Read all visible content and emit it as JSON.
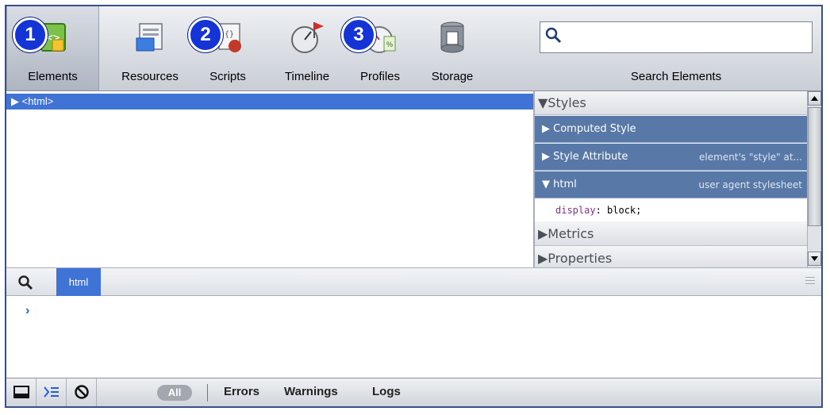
{
  "toolbar": {
    "tabs": [
      {
        "label": "Elements",
        "icon": "elements-icon",
        "selected": true,
        "badge": "1"
      },
      {
        "label": "Resources",
        "icon": "resources-icon",
        "selected": false,
        "badge": ""
      },
      {
        "label": "Scripts",
        "icon": "scripts-icon",
        "selected": false,
        "badge": "2"
      },
      {
        "label": "Timeline",
        "icon": "timeline-icon",
        "selected": false,
        "badge": ""
      },
      {
        "label": "Profiles",
        "icon": "profiles-icon",
        "selected": false,
        "badge": "3"
      },
      {
        "label": "Storage",
        "icon": "storage-icon",
        "selected": false,
        "badge": ""
      }
    ],
    "search": {
      "value": "",
      "label": "Search Elements"
    }
  },
  "elements_tree": {
    "rows": [
      {
        "text": "▶ <html>",
        "selected": true
      }
    ]
  },
  "sidebar": {
    "styles_header": "▼Styles",
    "computed_style": "▶ Computed Style",
    "style_attribute": {
      "label": "▶ Style Attribute",
      "source": "element's \"style\" at..."
    },
    "html_rule": {
      "label": "▼ html",
      "source": "user agent stylesheet"
    },
    "property": {
      "name": "display",
      "value": ": block;"
    },
    "metrics_header": "▶Metrics",
    "properties_header": "▶Properties"
  },
  "console_bar": {
    "scope_tag": "html"
  },
  "console": {
    "prompt": "›"
  },
  "status_bar": {
    "all_label": "All",
    "filters": [
      "Errors",
      "Warnings",
      "Logs"
    ]
  },
  "colors": {
    "selection": "#3f73d6",
    "badge": "#1434d6",
    "sidebar_section": "#5878a8"
  }
}
